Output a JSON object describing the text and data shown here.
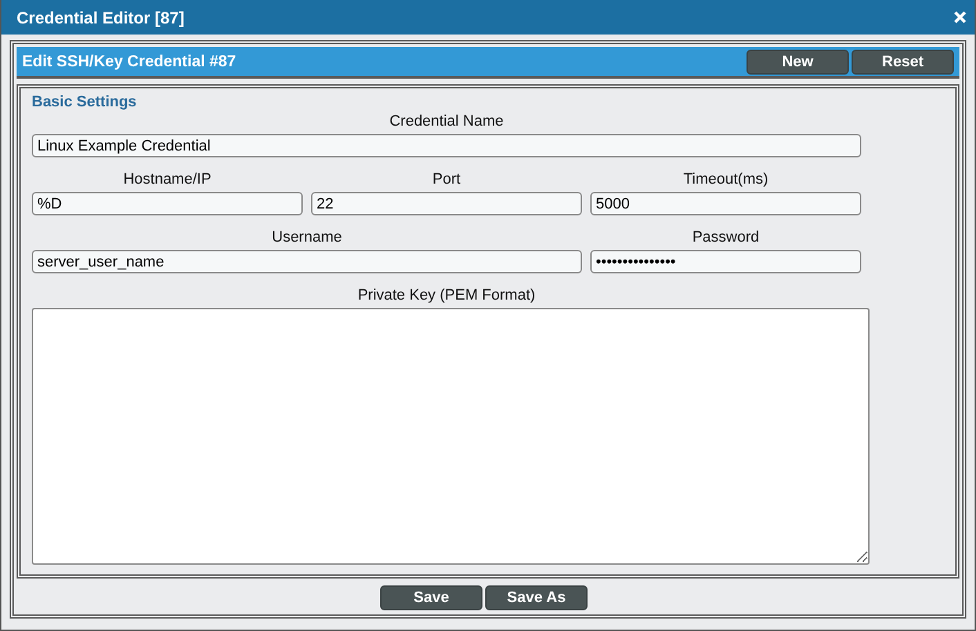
{
  "window": {
    "title": "Credential Editor [87]"
  },
  "panel": {
    "title": "Edit SSH/Key Credential #87",
    "buttons": [
      "New",
      "Reset"
    ]
  },
  "section": {
    "title": "Basic Settings"
  },
  "form_rows": [
    {
      "fields": [
        {
          "label": "Credential Name",
          "value": "Linux Example Credential",
          "kind": "wide"
        }
      ]
    },
    {
      "fields": [
        {
          "label": "Hostname/IP",
          "value": "%D",
          "kind": "single"
        },
        {
          "label": "Port",
          "value": "22",
          "kind": "single"
        },
        {
          "label": "Timeout(ms)",
          "value": "5000",
          "kind": "single"
        }
      ]
    },
    {
      "fields": [
        {
          "label": "Username",
          "value": "server_user_name",
          "kind": "double"
        },
        {
          "label": "Password",
          "value": "•••••••••••••••",
          "kind": "single"
        }
      ]
    },
    {
      "fields": [
        {
          "label": "Private Key (PEM Format)",
          "kind": "textarea"
        }
      ]
    }
  ],
  "footer_buttons": [
    "Save",
    "Save As"
  ]
}
